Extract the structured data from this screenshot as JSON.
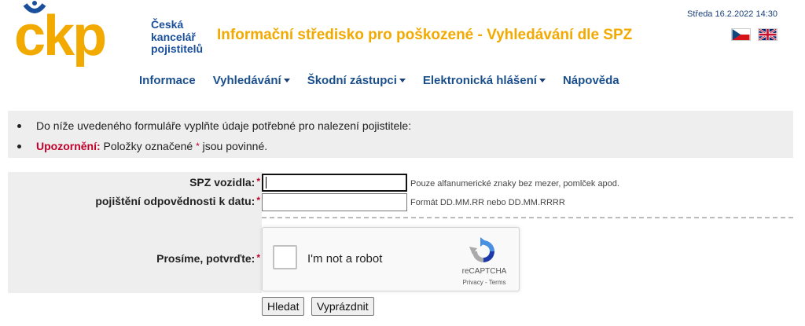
{
  "logo": {
    "mark": "čkp",
    "text_lines": [
      "Česká",
      "kancelář",
      "pojistitelů"
    ],
    "color_yellow": "#f2a900",
    "color_blue": "#1a4f9c"
  },
  "header": {
    "title": "Informační středisko pro poškozené - Vyhledávání dle SPZ",
    "datetime": "Středa 16.2.2022 14:30",
    "flags": [
      "czech-flag-icon",
      "uk-flag-icon"
    ]
  },
  "nav": {
    "items": [
      {
        "label": "Informace",
        "dropdown": false
      },
      {
        "label": "Vyhledávání",
        "dropdown": true
      },
      {
        "label": "Škodní zástupci",
        "dropdown": true
      },
      {
        "label": "Elektronická hlášení",
        "dropdown": true
      },
      {
        "label": "Nápověda",
        "dropdown": false
      }
    ]
  },
  "info": {
    "line1": "Do níže uvedeného formuláře vyplňte údaje potřebné pro nalezení pojistitele:",
    "warning_label": "Upozornění:",
    "warning_text_before": "Položky označené",
    "required_mark": "*",
    "warning_text_after": "jsou povinné."
  },
  "form": {
    "spz_label": "SPZ vozidla:",
    "spz_value": "",
    "spz_hint": "Pouze alfanumerické znaky bez mezer, pomlček apod.",
    "date_label": "pojištění odpovědnosti k datu:",
    "date_value": "",
    "date_hint": "Formát DD.MM.RR nebo DD.MM.RRRR",
    "captcha_label": "Prosíme, potvrďte:",
    "required_mark": "*"
  },
  "captcha": {
    "text": "I'm not a robot",
    "brand": "reCAPTCHA",
    "links": "Privacy - Terms"
  },
  "buttons": {
    "search": "Hledat",
    "clear": "Vyprázdnit"
  }
}
